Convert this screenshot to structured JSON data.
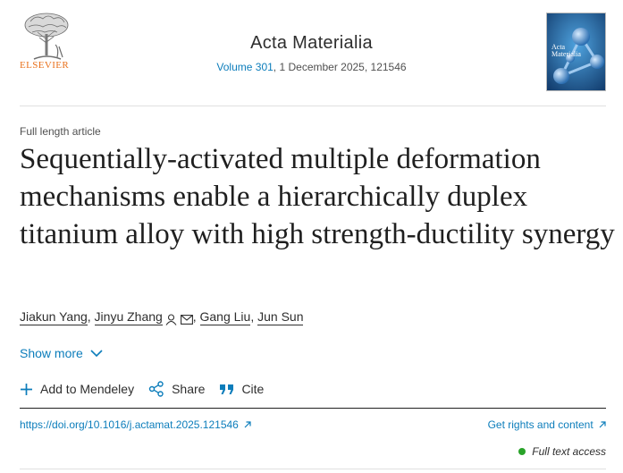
{
  "header": {
    "publisher": "ELSEVIER",
    "journal": "Acta Materialia",
    "volume": "Volume 301",
    "issue_rest": ", 1 December 2025, 121546",
    "cover_journal": "Acta Materialia"
  },
  "article": {
    "type": "Full length article",
    "title": "Sequentially-activated multiple deformation mechanisms enable a hierarchically duplex titanium alloy with high strength-ductility synergy"
  },
  "authors": [
    {
      "name": "Jiakun Yang",
      "sep": ", "
    },
    {
      "name": "Jinyu Zhang",
      "sep": ", "
    },
    {
      "name": "Gang Liu",
      "sep": ", "
    },
    {
      "name": "Jun Sun",
      "sep": ""
    }
  ],
  "show_more": "Show more",
  "actions": {
    "mendeley": "Add to Mendeley",
    "share": "Share",
    "cite": "Cite"
  },
  "links": {
    "doi": "https://doi.org/10.1016/j.actamat.2025.121546",
    "rights": "Get rights and content"
  },
  "access": "Full text access",
  "colors": {
    "link": "#0c7dbb",
    "publisher_orange": "#e9711c",
    "access_green": "#29a329"
  },
  "icons": [
    "elsevier-tree-logo",
    "person-icon",
    "envelope-icon",
    "chevron-down-icon",
    "plus-icon",
    "share-icon",
    "quote-icon",
    "external-arrow-icon"
  ]
}
